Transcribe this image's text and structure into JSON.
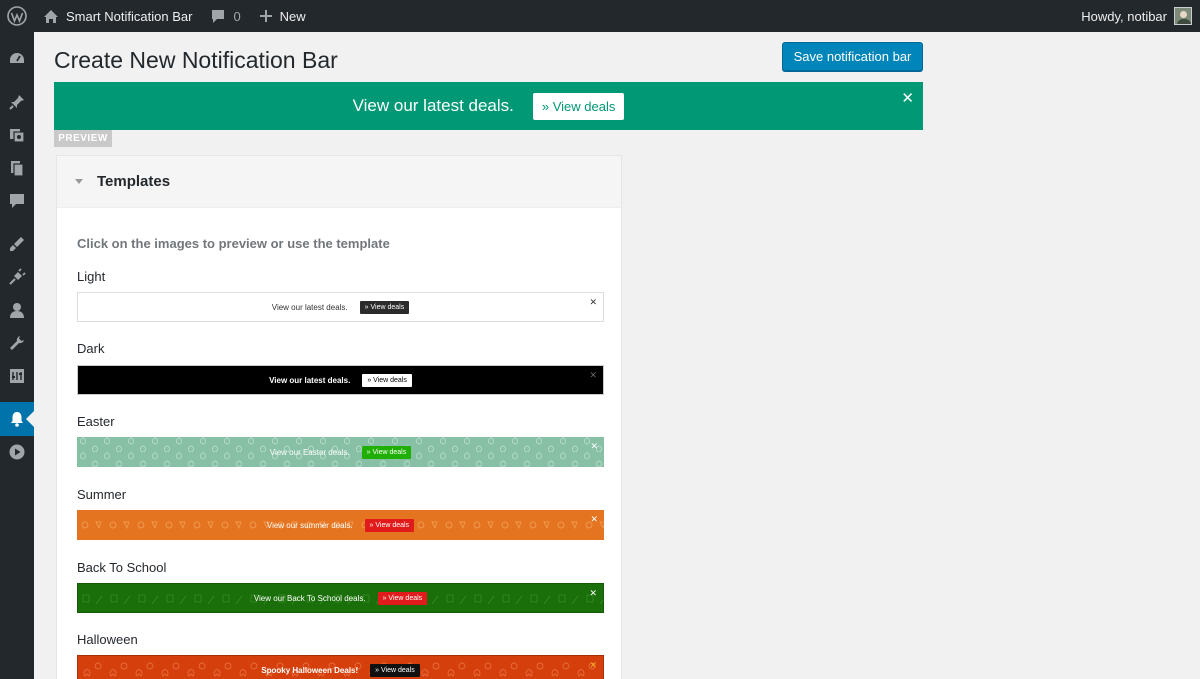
{
  "adminbar": {
    "site_name": "Smart Notification Bar",
    "comments_count": "0",
    "new_label": "New",
    "howdy": "Howdy, notibar"
  },
  "page": {
    "title": "Create New Notification Bar",
    "save_label": "Save notification bar"
  },
  "preview": {
    "text": "View our latest deals.",
    "button": "» View deals",
    "close": "✕",
    "tag": "PREVIEW",
    "color": "#009875"
  },
  "templates": {
    "heading": "Templates",
    "instructions": "Click on the images to preview or use the template",
    "items": [
      {
        "name": "Light",
        "text": "View our latest deals.",
        "button": "» View deals",
        "close": "✕"
      },
      {
        "name": "Dark",
        "text": "View our latest deals.",
        "button": "» View deals",
        "close": "✕"
      },
      {
        "name": "Easter",
        "text": "View our Easter deals.",
        "button": "» View deals",
        "close": "✕"
      },
      {
        "name": "Summer",
        "text": "View our summer deals.",
        "button": "» View deals",
        "close": "✕"
      },
      {
        "name": "Back To School",
        "text": "View our Back To School deals.",
        "button": "» View deals",
        "close": "✕"
      },
      {
        "name": "Halloween",
        "text": "Spooky Halloween Deals!",
        "button": "» View deals",
        "close": "✕"
      }
    ]
  },
  "menu_icons": [
    "dashboard-icon",
    "posts-icon",
    "media-icon",
    "pages-icon",
    "comments-icon",
    "appearance-icon",
    "plugins-icon",
    "users-icon",
    "tools-icon",
    "settings-icon",
    "notification-bell-icon",
    "play-icon"
  ],
  "colors": {
    "admin_dark": "#23282d",
    "wp_blue": "#0085ba",
    "active_menu": "#0073aa"
  }
}
